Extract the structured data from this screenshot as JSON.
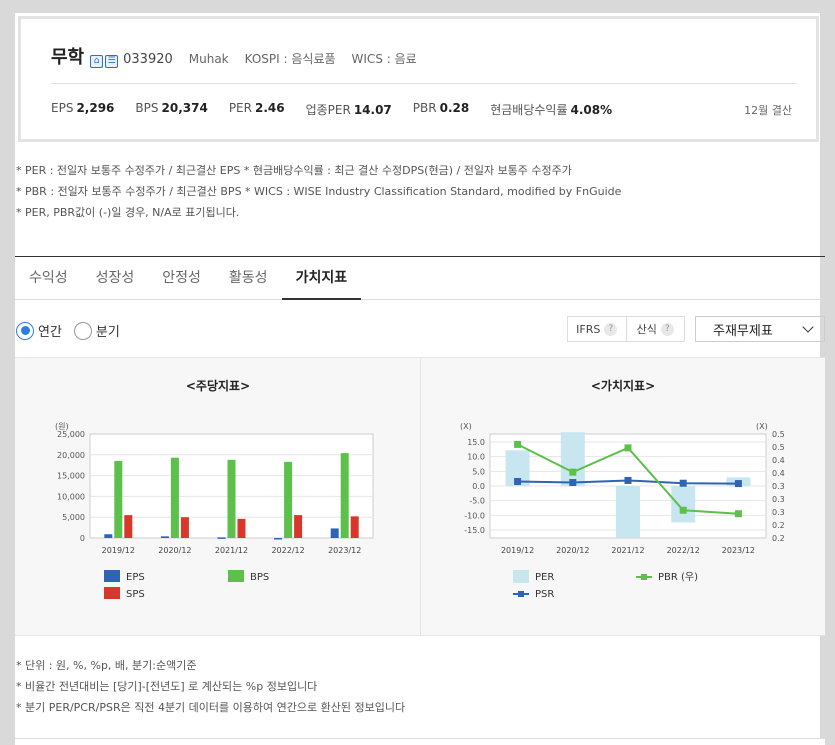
{
  "company": {
    "name": "무학",
    "icons": [
      "home-icon",
      "share-icon"
    ],
    "code": "033920",
    "english_name": "Muhak",
    "market": "KOSPI : 음식료품",
    "wics": "WICS : 음료"
  },
  "metrics": [
    {
      "label": "EPS",
      "value": "2,296"
    },
    {
      "label": "BPS",
      "value": "20,374"
    },
    {
      "label": "PER",
      "value": "2.46"
    },
    {
      "label": "업종PER",
      "value": "14.07"
    },
    {
      "label": "PBR",
      "value": "0.28"
    },
    {
      "label": "현금배당수익률",
      "value": "4.08%"
    }
  ],
  "settlement": "12월 결산",
  "notes": [
    "* PER : 전일자 보통주 수정주가 / 최근결산 EPS * 현금배당수익률 : 최근 결산 수정DPS(현금) / 전일자 보통주 수정주가",
    "* PBR : 전일자 보통주 수정주가 / 최근결산 BPS * WICS : WISE Industry Classification Standard, modified by FnGuide",
    "* PER, PBR값이 (-)일 경우, N/A로 표기됩니다."
  ],
  "tabs": [
    "수익성",
    "성장성",
    "안정성",
    "활동성",
    "가치지표"
  ],
  "active_tab": "가치지표",
  "period": {
    "annual": "연간",
    "quarter": "분기",
    "selected": "연간"
  },
  "options": {
    "ifrs": "IFRS",
    "formula": "산식",
    "help": "?"
  },
  "stock_select": "주재무제표",
  "chart_data": [
    {
      "type": "bar",
      "title": "<주당지표>",
      "unit_label": "(원)",
      "categories": [
        "2019/12",
        "2020/12",
        "2021/12",
        "2022/12",
        "2023/12"
      ],
      "ylim": [
        0,
        25000
      ],
      "yticks": [
        "25,000",
        "20,000",
        "15,000",
        "10,000",
        "5,000",
        "0"
      ],
      "series": [
        {
          "name": "EPS",
          "color": "#2f63b3",
          "values": [
            900,
            400,
            150,
            -100,
            2300
          ]
        },
        {
          "name": "BPS",
          "color": "#5cc04a",
          "values": [
            18500,
            19300,
            18800,
            18300,
            20400
          ]
        },
        {
          "name": "SPS",
          "color": "#d9372b",
          "values": [
            5500,
            5000,
            4600,
            5500,
            5200
          ]
        }
      ],
      "grid": true,
      "legend": "bottom"
    },
    {
      "type": "bar+line",
      "title": "<가치지표>",
      "left_unit": "(X)",
      "right_unit": "(X)",
      "categories": [
        "2019/12",
        "2020/12",
        "2021/12",
        "2022/12",
        "2023/12"
      ],
      "ylim_left": [
        -15,
        15
      ],
      "yticks_left": [
        "15.0",
        "10.0",
        "5.0",
        "0.0",
        "-5.0",
        "-10.0",
        "-15.0"
      ],
      "ylim_right": [
        0.2,
        0.5
      ],
      "yticks_right": [
        "0.5",
        "0.5",
        "0.4",
        "0.4",
        "0.3",
        "0.3",
        "0.3",
        "0.2",
        "0.2"
      ],
      "series": [
        {
          "name": "PER",
          "color": "#c8e6ef",
          "axis": "left",
          "kind": "bar",
          "values": [
            10.3,
            15.5,
            -14.8,
            -10.5,
            2.5
          ]
        },
        {
          "name": "PSR",
          "color": "#2f63b3",
          "axis": "left",
          "kind": "line",
          "values": [
            1.3,
            1.0,
            1.6,
            0.8,
            0.7
          ]
        },
        {
          "name": "PBR (우)",
          "color": "#5cc04a",
          "axis": "right",
          "kind": "line",
          "values": [
            0.47,
            0.39,
            0.46,
            0.28,
            0.27
          ]
        }
      ],
      "grid": true,
      "legend": "bottom"
    }
  ],
  "footnotes": [
    "* 단위 : 원, %, %p, 배, 분기:순액기준",
    "* 비율간 전년대비는 [당기]-[전년도] 로 계산되는 %p 정보입니다",
    "* 분기 PER/PCR/PSR은 직전 4분기 데이터를 이용하여 연간으로 환산된 정보입니다"
  ]
}
